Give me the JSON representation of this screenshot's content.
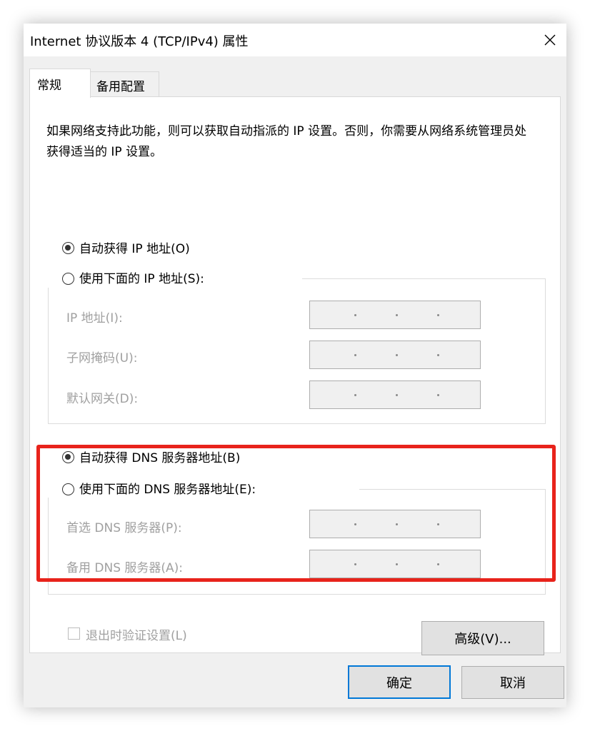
{
  "window": {
    "title": "Internet 协议版本 4 (TCP/IPv4) 属性",
    "close_icon": "×"
  },
  "tabs": [
    {
      "label": "常规",
      "active": true
    },
    {
      "label": "备用配置",
      "active": false
    }
  ],
  "general": {
    "intro": "如果网络支持此功能，则可以获取自动指派的 IP 设置。否则，你需要从网络系统管理员处获得适当的 IP 设置。",
    "ip_auto_label": "自动获得 IP 地址(O)",
    "ip_manual_label": "使用下面的 IP 地址(S):",
    "ip_fields": [
      {
        "label": "IP 地址(I):",
        "value": ". . ."
      },
      {
        "label": "子网掩码(U):",
        "value": ". . ."
      },
      {
        "label": "默认网关(D):",
        "value": ". . ."
      }
    ],
    "dns_auto_label": "自动获得 DNS 服务器地址(B)",
    "dns_manual_label": "使用下面的 DNS 服务器地址(E):",
    "dns_fields": [
      {
        "label": "首选 DNS 服务器(P):",
        "value": ". . ."
      },
      {
        "label": "备用 DNS 服务器(A):",
        "value": ". . ."
      }
    ],
    "validate_label": "退出时验证设置(L)",
    "advanced_button": "高级(V)..."
  },
  "footer": {
    "ok_button": "确定",
    "cancel_button": "取消"
  },
  "state": {
    "ip_mode": "auto",
    "dns_mode": "auto",
    "validate_checked": false
  },
  "colors": {
    "highlight": "#e8231b",
    "primary_border": "#0078d7"
  }
}
